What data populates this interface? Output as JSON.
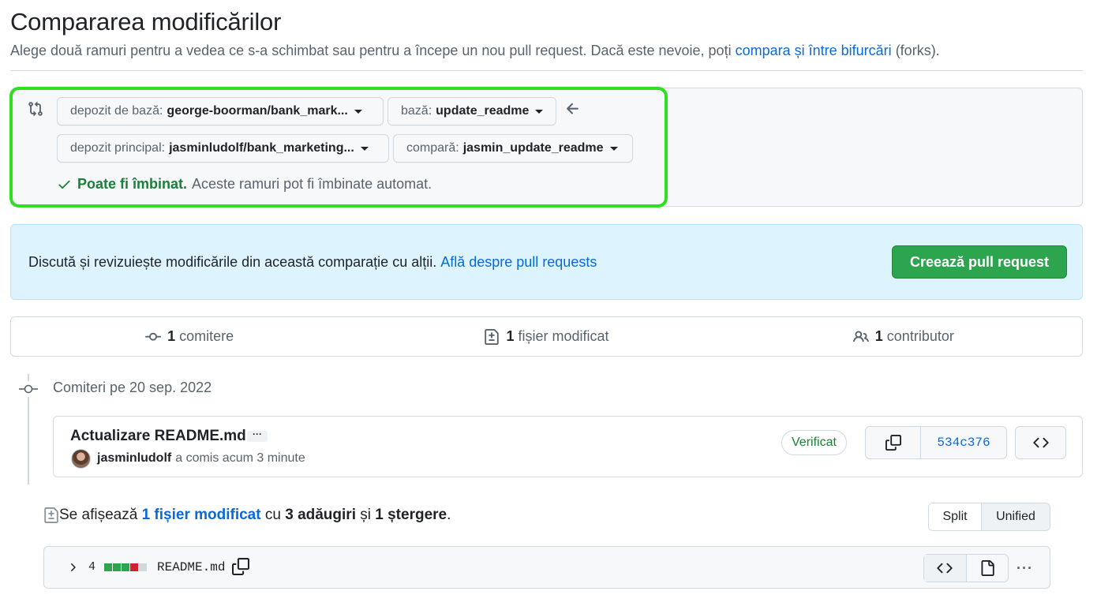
{
  "header": {
    "title": "Compararea modificărilor",
    "subtitle": "Alege două ramuri pentru a vedea ce s-a schimbat sau pentru a începe un nou pull request. Dacă este nevoie, poți",
    "subtitle_link": "compara și între bifurcări",
    "subtitle_suffix": "(forks)."
  },
  "range": {
    "base_repo_label": "depozit de bază:",
    "base_repo_value": "george-boorman/bank_mark...",
    "base_label": "bază:",
    "base_value": "update_readme",
    "head_repo_label": "depozit principal:",
    "head_repo_value": "jasminludolf/bank_marketing...",
    "compare_label": "compară:",
    "compare_value": "jasmin_update_readme",
    "merge_ok": "Poate fi îmbinat.",
    "merge_text": "Aceste ramuri pot fi îmbinate automat."
  },
  "banner": {
    "text": "Discută și revizuiește modificările din această comparație cu alții.",
    "link": "Află despre pull requests",
    "button": "Creează pull request"
  },
  "summary": {
    "commits_count": "1",
    "commits_label": "comitere",
    "files_count": "1",
    "files_label": "fișier modificat",
    "contributors_count": "1",
    "contributors_label": "contributor"
  },
  "commits": {
    "date_heading": "Comiteri pe 20 sep. 2022",
    "message": "Actualizare README.md",
    "ellipsis": "···",
    "author": "jasminludolf",
    "committed_text": "a comis acum 3 minute",
    "verified": "Verificat",
    "sha": "534c376"
  },
  "diff": {
    "prefix": "Se afișează",
    "files_link": "1 fișier modificat",
    "with": "cu",
    "additions": "3 adăugiri",
    "and": "și",
    "deletions": "1 ștergere",
    "period": ".",
    "split_label": "Split",
    "unified_label": "Unified",
    "file_changes": "4",
    "file_name": "README.md",
    "kebab": "···"
  },
  "colors": {
    "highlight": "#2fe01f",
    "addition": "#2da44e",
    "deletion": "#cf222e",
    "neutral": "#d1d9e0",
    "link": "#0969da",
    "primary_button": "#2da44e"
  }
}
